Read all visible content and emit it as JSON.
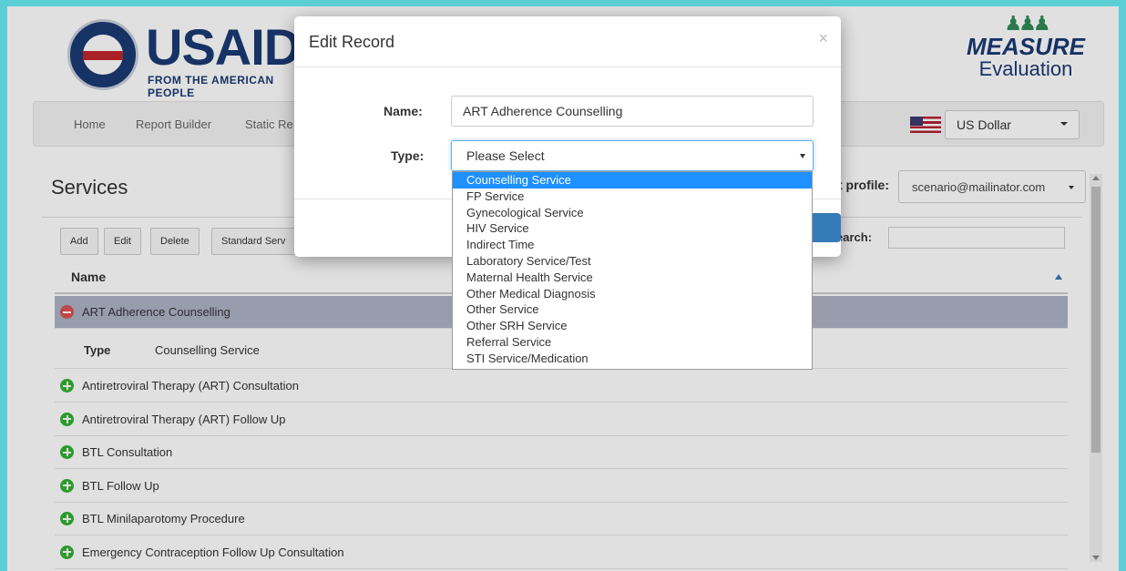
{
  "header": {
    "usaid_wordmark": "USAID",
    "usaid_tagline": "FROM THE AMERICAN PEOPLE",
    "usaid_seal_text": "USAID",
    "measure_title": "MEASURE",
    "measure_subtitle": "Evaluation"
  },
  "nav": {
    "items": [
      "Home",
      "Report Builder",
      "Static Re"
    ],
    "currency": "US Dollar"
  },
  "services": {
    "title": "Services",
    "profile_label": "t profile:",
    "profile_value": "scenario@mailinator.com",
    "buttons": [
      "Add",
      "Edit",
      "Delete",
      "Standard Serv"
    ],
    "search_label": "earch:",
    "column_name": "Name",
    "selected_row": "ART Adherence Counselling",
    "detail_key": "Type",
    "detail_value": "Counselling Service",
    "rows": [
      "Antiretroviral Therapy (ART) Consultation",
      "Antiretroviral Therapy (ART) Follow Up",
      "BTL Consultation",
      "BTL Follow Up",
      "BTL Minilaparotomy Procedure",
      "Emergency Contraception Follow Up Consultation"
    ]
  },
  "modal": {
    "title": "Edit Record",
    "close": "×",
    "name_label": "Name:",
    "name_value": "ART Adherence Counselling",
    "type_label": "Type:",
    "type_value": "Please Select",
    "type_options": [
      "Counselling Service",
      "FP Service",
      "Gynecological Service",
      "HIV Service",
      "Indirect Time",
      "Laboratory Service/Test",
      "Maternal Health Service",
      "Other Medical Diagnosis",
      "Other Service",
      "Other SRH Service",
      "Referral Service",
      "STI Service/Medication"
    ],
    "highlighted_option": "Counselling Service"
  },
  "colors": {
    "accent": "#337ab7",
    "selected_row": "#aeb3c6",
    "highlight": "#1e90ff",
    "plus_icon": "#31b131",
    "minus_icon": "#d9534f",
    "frame": "#5ccfd6"
  }
}
